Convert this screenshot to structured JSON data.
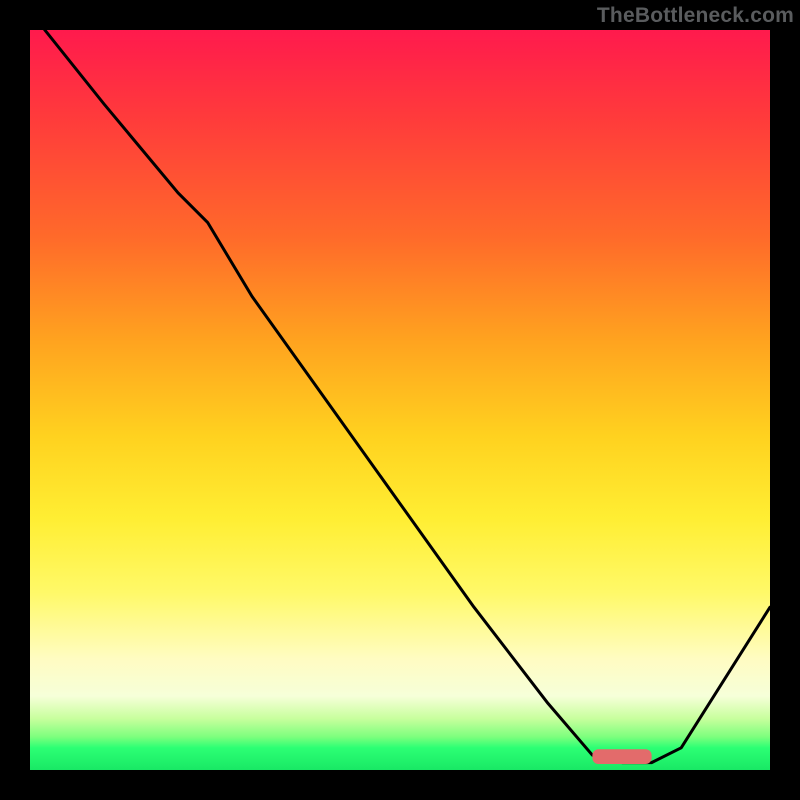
{
  "watermark": "TheBottleneck.com",
  "chart_data": {
    "type": "line",
    "title": "",
    "xlabel": "",
    "ylabel": "",
    "xlim": [
      0,
      100
    ],
    "ylim": [
      0,
      100
    ],
    "grid": false,
    "legend": false,
    "series": [
      {
        "name": "bottleneck-curve",
        "color": "#000000",
        "x": [
          2,
          10,
          20,
          24,
          30,
          40,
          50,
          60,
          70,
          76,
          80,
          84,
          88,
          100
        ],
        "y": [
          100,
          90,
          78,
          74,
          64,
          50,
          36,
          22,
          9,
          2,
          1,
          1,
          3,
          22
        ]
      },
      {
        "name": "optimal-marker",
        "type": "bar",
        "color": "#e36b6b",
        "x": [
          80
        ],
        "width": 8,
        "y": [
          2
        ]
      }
    ],
    "background_gradient": {
      "top": "#ff1a4d",
      "upper_mid": "#ffd21f",
      "lower_mid": "#fffcc2",
      "bottom": "#19e865"
    }
  }
}
